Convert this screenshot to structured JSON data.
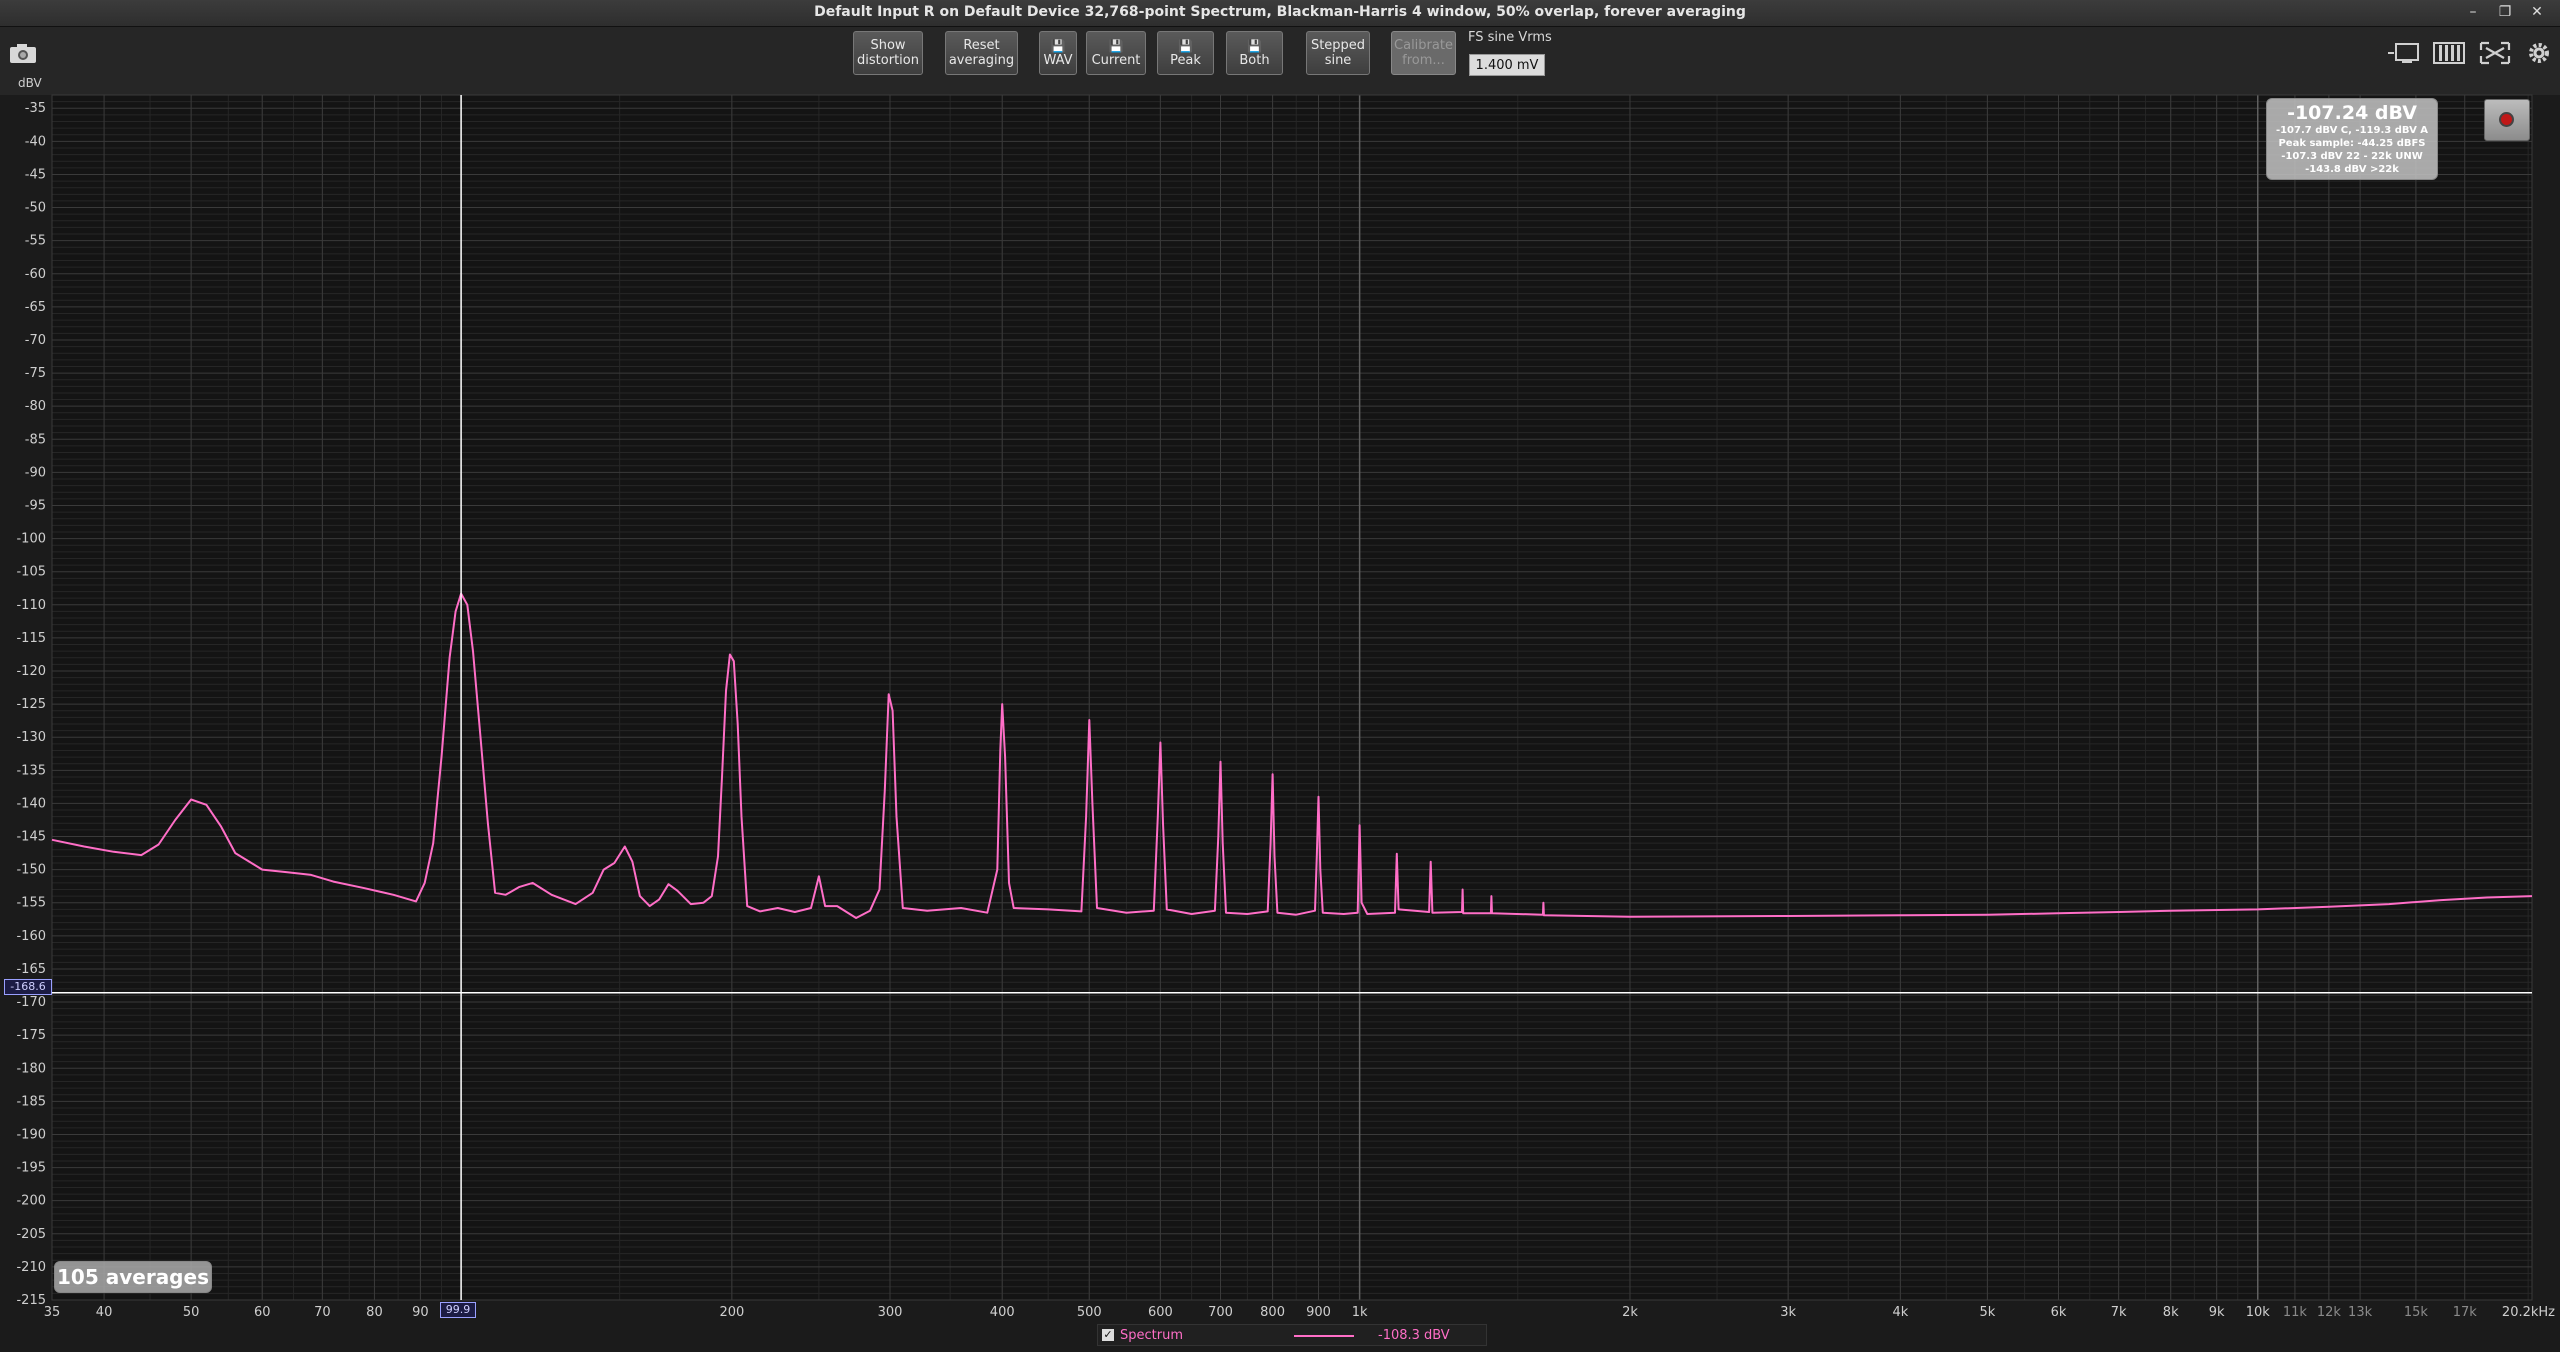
{
  "window": {
    "title": "Default Input R on Default Device 32,768-point Spectrum, Blackman-Harris 4 window, 50% overlap, forever averaging",
    "minimize_glyph": "–",
    "restore_glyph": "❐",
    "close_glyph": "✕"
  },
  "toolbar": {
    "show_distortion_l1": "Show",
    "show_distortion_l2": "distortion",
    "reset_averaging_l1": "Reset",
    "reset_averaging_l2": "averaging",
    "wav_label": "WAV",
    "current_label": "Current",
    "peak_label": "Peak",
    "both_label": "Both",
    "stepped_sine_l1": "Stepped",
    "stepped_sine_l2": "sine",
    "calibrate_l1": "Calibrate",
    "calibrate_l2": "from...",
    "fs_sine_label": "FS sine Vrms",
    "fs_sine_value": "1.400 mV",
    "save_glyph": "💾"
  },
  "icons": {
    "camera": "camera-icon",
    "display": "monitor-icon",
    "bars": "bars-icon",
    "fullscreen": "fullscreen-icon",
    "settings": "gear-icon",
    "record": "record-icon"
  },
  "readout": {
    "main": "-107.24 dBV",
    "line1": "-107.7 dBV C, -119.3 dBV A",
    "line2": "Peak sample: -44.25 dBFS",
    "line3": "-107.3 dBV 22 - 22k UNW",
    "line4": "-143.8 dBV >22k"
  },
  "status": {
    "averages": "105 averages"
  },
  "cursor": {
    "y_value": -168.6,
    "y_label": "-168.6",
    "x_value": 99.9,
    "x_label": "99.9"
  },
  "legend": {
    "checked_glyph": "✓",
    "name": "Spectrum",
    "value": "-108.3 dBV"
  },
  "colors": {
    "trace": "#ff6ec7",
    "background": "#141414",
    "grid_major": "#3a3a3a",
    "grid_minor": "#262626",
    "cursor": "#ffffff"
  },
  "chart_data": {
    "type": "line",
    "title": "Default Input R on Default Device 32,768-point Spectrum, Blackman-Harris 4 window, 50% overlap, forever averaging",
    "xlabel": "",
    "ylabel": "dBV",
    "x_scale": "log",
    "xlim": [
      35,
      20200
    ],
    "ylim": [
      -215,
      -33
    ],
    "grid": true,
    "x_ticks": [
      {
        "v": 35,
        "label": "35",
        "major": true
      },
      {
        "v": 40,
        "label": "40",
        "major": true
      },
      {
        "v": 50,
        "label": "50",
        "major": true
      },
      {
        "v": 60,
        "label": "60",
        "major": true
      },
      {
        "v": 70,
        "label": "70",
        "major": true
      },
      {
        "v": 80,
        "label": "80",
        "major": true
      },
      {
        "v": 90,
        "label": "90",
        "major": true
      },
      {
        "v": 200,
        "label": "200",
        "major": true
      },
      {
        "v": 300,
        "label": "300",
        "major": true
      },
      {
        "v": 400,
        "label": "400",
        "major": true
      },
      {
        "v": 500,
        "label": "500",
        "major": true
      },
      {
        "v": 600,
        "label": "600",
        "major": true
      },
      {
        "v": 700,
        "label": "700",
        "major": true
      },
      {
        "v": 800,
        "label": "800",
        "major": true
      },
      {
        "v": 900,
        "label": "900",
        "major": true
      },
      {
        "v": 1000,
        "label": "1k",
        "major": true
      },
      {
        "v": 2000,
        "label": "2k",
        "major": true
      },
      {
        "v": 3000,
        "label": "3k",
        "major": true
      },
      {
        "v": 4000,
        "label": "4k",
        "major": true
      },
      {
        "v": 5000,
        "label": "5k",
        "major": true
      },
      {
        "v": 6000,
        "label": "6k",
        "major": true
      },
      {
        "v": 7000,
        "label": "7k",
        "major": true
      },
      {
        "v": 8000,
        "label": "8k",
        "major": true
      },
      {
        "v": 9000,
        "label": "9k",
        "major": true
      },
      {
        "v": 10000,
        "label": "10k",
        "major": true
      },
      {
        "v": 11000,
        "label": "11k",
        "major": false
      },
      {
        "v": 12000,
        "label": "12k",
        "major": false
      },
      {
        "v": 13000,
        "label": "13k",
        "major": false
      },
      {
        "v": 15000,
        "label": "15k",
        "major": false
      },
      {
        "v": 17000,
        "label": "17k",
        "major": false
      },
      {
        "v": 20200,
        "label": "20.2kHz",
        "major": true
      }
    ],
    "y_ticks": [
      -35,
      -40,
      -45,
      -50,
      -55,
      -60,
      -65,
      -70,
      -75,
      -80,
      -85,
      -90,
      -95,
      -100,
      -105,
      -110,
      -115,
      -120,
      -125,
      -130,
      -135,
      -140,
      -145,
      -150,
      -155,
      -160,
      -165,
      -170,
      -175,
      -180,
      -185,
      -190,
      -195,
      -200,
      -205,
      -210,
      -215
    ],
    "series": [
      {
        "name": "Spectrum",
        "color": "#ff6ec7",
        "points": [
          [
            35,
            -145.5
          ],
          [
            38,
            -146.5
          ],
          [
            41,
            -147.3
          ],
          [
            44,
            -147.8
          ],
          [
            46,
            -146.2
          ],
          [
            48,
            -142.5
          ],
          [
            50,
            -139.4
          ],
          [
            52,
            -140.2
          ],
          [
            54,
            -143.5
          ],
          [
            56,
            -147.5
          ],
          [
            60,
            -150.0
          ],
          [
            64,
            -150.4
          ],
          [
            68,
            -150.8
          ],
          [
            72,
            -151.8
          ],
          [
            78,
            -152.8
          ],
          [
            84,
            -153.8
          ],
          [
            89,
            -154.8
          ],
          [
            91,
            -152
          ],
          [
            93,
            -146
          ],
          [
            95,
            -133
          ],
          [
            97,
            -118
          ],
          [
            98.5,
            -111
          ],
          [
            99.9,
            -108.3
          ],
          [
            101.5,
            -110
          ],
          [
            103,
            -117
          ],
          [
            105,
            -130
          ],
          [
            107,
            -143
          ],
          [
            109,
            -153.5
          ],
          [
            112,
            -153.8
          ],
          [
            116,
            -152.6
          ],
          [
            120,
            -152.0
          ],
          [
            126,
            -153.8
          ],
          [
            134,
            -155.2
          ],
          [
            140,
            -153.5
          ],
          [
            144,
            -150
          ],
          [
            148,
            -149
          ],
          [
            152,
            -146.5
          ],
          [
            155,
            -148.8
          ],
          [
            158,
            -154
          ],
          [
            162,
            -155.5
          ],
          [
            166,
            -154.5
          ],
          [
            170,
            -152.2
          ],
          [
            174,
            -153.2
          ],
          [
            180,
            -155.2
          ],
          [
            186,
            -155
          ],
          [
            190,
            -154
          ],
          [
            193,
            -148
          ],
          [
            195,
            -136
          ],
          [
            197,
            -123
          ],
          [
            199,
            -117.5
          ],
          [
            201,
            -118.5
          ],
          [
            203,
            -128
          ],
          [
            205,
            -142
          ],
          [
            208,
            -155.5
          ],
          [
            215,
            -156.3
          ],
          [
            225,
            -155.8
          ],
          [
            235,
            -156.4
          ],
          [
            245,
            -155.8
          ],
          [
            250,
            -151
          ],
          [
            254,
            -155.5
          ],
          [
            262,
            -155.5
          ],
          [
            275,
            -157.3
          ],
          [
            285,
            -156.2
          ],
          [
            292,
            -153
          ],
          [
            296,
            -138
          ],
          [
            299,
            -123.5
          ],
          [
            302,
            -126
          ],
          [
            305,
            -142
          ],
          [
            310,
            -155.8
          ],
          [
            330,
            -156.2
          ],
          [
            360,
            -155.8
          ],
          [
            385,
            -156.5
          ],
          [
            395,
            -150
          ],
          [
            398,
            -132
          ],
          [
            400,
            -125
          ],
          [
            403,
            -133
          ],
          [
            407,
            -152
          ],
          [
            412,
            -155.8
          ],
          [
            450,
            -156
          ],
          [
            490,
            -156.3
          ],
          [
            496,
            -142
          ],
          [
            500,
            -127.4
          ],
          [
            504,
            -140
          ],
          [
            510,
            -155.8
          ],
          [
            550,
            -156.5
          ],
          [
            590,
            -156.2
          ],
          [
            596,
            -142
          ],
          [
            600,
            -130.8
          ],
          [
            604,
            -143
          ],
          [
            610,
            -156
          ],
          [
            650,
            -156.7
          ],
          [
            690,
            -156.2
          ],
          [
            696,
            -145
          ],
          [
            700,
            -133.7
          ],
          [
            704,
            -146
          ],
          [
            710,
            -156.5
          ],
          [
            750,
            -156.7
          ],
          [
            790,
            -156.3
          ],
          [
            796,
            -146
          ],
          [
            800,
            -135.6
          ],
          [
            804,
            -148
          ],
          [
            810,
            -156.5
          ],
          [
            850,
            -156.8
          ],
          [
            892,
            -156.2
          ],
          [
            896,
            -148
          ],
          [
            900,
            -139
          ],
          [
            904,
            -150
          ],
          [
            910,
            -156.5
          ],
          [
            960,
            -156.7
          ],
          [
            995,
            -156.5
          ],
          [
            1000,
            -143.3
          ],
          [
            1005,
            -155
          ],
          [
            1020,
            -156.7
          ],
          [
            1095,
            -156.5
          ],
          [
            1100,
            -147.6
          ],
          [
            1105,
            -156
          ],
          [
            1195,
            -156.4
          ],
          [
            1200,
            -148.8
          ],
          [
            1205,
            -156.5
          ],
          [
            1300,
            -156.4
          ],
          [
            1302,
            -153.0
          ],
          [
            1304,
            -156.6
          ],
          [
            1400,
            -156.6
          ],
          [
            1402,
            -154.0
          ],
          [
            1404,
            -156.6
          ],
          [
            1600,
            -156.8
          ],
          [
            1602,
            -155.0
          ],
          [
            1604,
            -156.9
          ],
          [
            2000,
            -157.1
          ],
          [
            3000,
            -157.0
          ],
          [
            4000,
            -156.9
          ],
          [
            5000,
            -156.8
          ],
          [
            6000,
            -156.6
          ],
          [
            7000,
            -156.4
          ],
          [
            8000,
            -156.2
          ],
          [
            10000,
            -156.0
          ],
          [
            12000,
            -155.6
          ],
          [
            14000,
            -155.2
          ],
          [
            16000,
            -154.6
          ],
          [
            18000,
            -154.2
          ],
          [
            20200,
            -154.0
          ]
        ]
      }
    ]
  }
}
